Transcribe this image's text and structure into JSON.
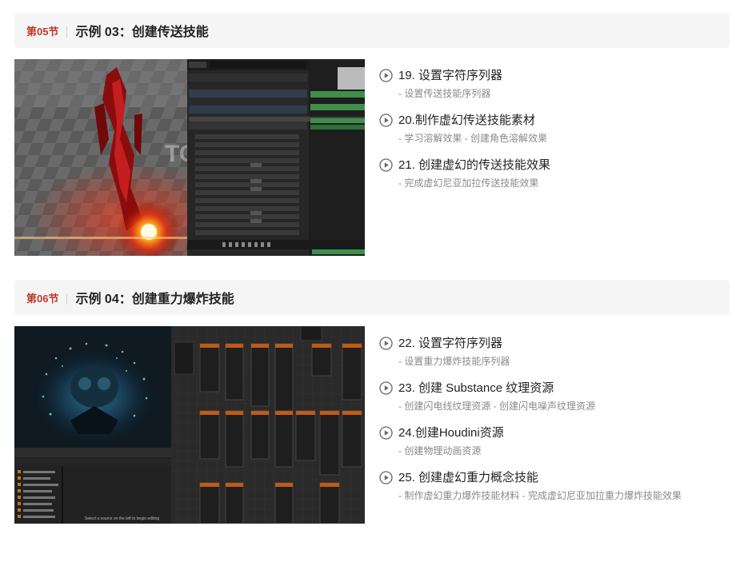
{
  "sections": [
    {
      "num": "第05节",
      "title": "示例 03：创建传送技能",
      "lessons": [
        {
          "title": "19. 设置字符序列器",
          "sub": "- 设置传送技能序列器"
        },
        {
          "title": "20.制作虚幻传送技能素材",
          "sub": "- 学习溶解效果 - 创建角色溶解效果"
        },
        {
          "title": "21. 创建虚幻的传送技能效果",
          "sub": "- 完成虚幻尼亚加拉传送技能效果"
        }
      ],
      "watermark": "TOMCG"
    },
    {
      "num": "第06节",
      "title": "示例 04：创建重力爆炸技能",
      "lessons": [
        {
          "title": "22. 设置字符序列器",
          "sub": "- 设置重力爆炸技能序列器"
        },
        {
          "title": "23. 创建 Substance 纹理资源",
          "sub": "- 创建闪电线纹理资源 - 创建闪电噪声纹理资源"
        },
        {
          "title": "24.创建Houdini资源",
          "sub": "- 创建物理动画资源"
        },
        {
          "title": "25. 创建虚幻重力概念技能",
          "sub": "- 制作虚幻重力爆炸技能材料 - 完成虚幻尼亚加拉重力爆炸技能效果"
        }
      ],
      "status_text": "Select a source on the left to begin editing"
    }
  ]
}
